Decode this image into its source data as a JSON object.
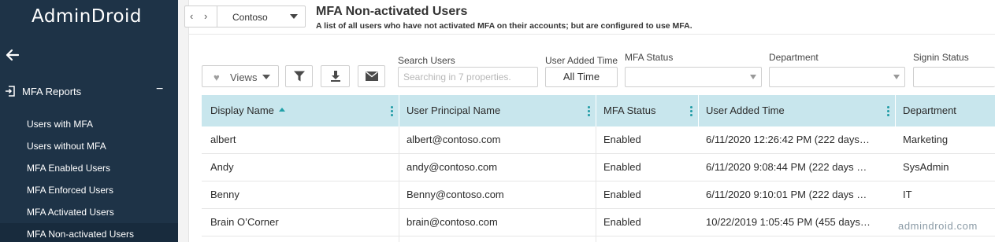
{
  "app": {
    "name": "AdminDroid"
  },
  "sidebar": {
    "section": {
      "label": "MFA Reports",
      "toggle": "−"
    },
    "items": [
      {
        "label": "Users with MFA"
      },
      {
        "label": "Users without MFA"
      },
      {
        "label": "MFA Enabled Users"
      },
      {
        "label": "MFA Enforced Users"
      },
      {
        "label": "MFA Activated Users"
      },
      {
        "label": "MFA Non-activated Users",
        "active": true
      }
    ]
  },
  "header": {
    "tenant": "Contoso",
    "prev": "‹",
    "next": "›",
    "title": "MFA Non-activated Users",
    "subtitle": "A list of all users who have not activated MFA on their accounts; but are configured to use MFA."
  },
  "toolbar": {
    "views_label": "Views",
    "search_label": "Search Users",
    "search_placeholder": "Searching in 7 properties.",
    "time_label": "User Added Time",
    "time_value": "All Time",
    "mfa_label": "MFA Status",
    "dept_label": "Department",
    "signin_label": "Signin Status"
  },
  "table": {
    "columns": [
      {
        "label": "Display Name"
      },
      {
        "label": "User Principal Name"
      },
      {
        "label": "MFA Status"
      },
      {
        "label": "User Added Time"
      },
      {
        "label": "Department"
      }
    ],
    "rows": [
      [
        "albert",
        "albert@contoso.com",
        "Enabled",
        "6/11/2020 12:26:42 PM (222 days…",
        "Marketing"
      ],
      [
        "Andy",
        "andy@contoso.com",
        "Enabled",
        "6/11/2020 9:08:44 PM (222 days …",
        "SysAdmin"
      ],
      [
        "Benny",
        "Benny@contoso.com",
        "Enabled",
        "6/11/2020 9:10:01 PM (222 days …",
        "IT"
      ],
      [
        "Brain O’Corner",
        "brain@contoso.com",
        "Enabled",
        "10/22/2019 1:05:45 PM (455 days…",
        ""
      ]
    ]
  },
  "watermark": "admindroid.com",
  "colors": {
    "sidebar": "#1e3347",
    "grid_header": "#c8e6ed",
    "accent": "#1f9aa4"
  }
}
